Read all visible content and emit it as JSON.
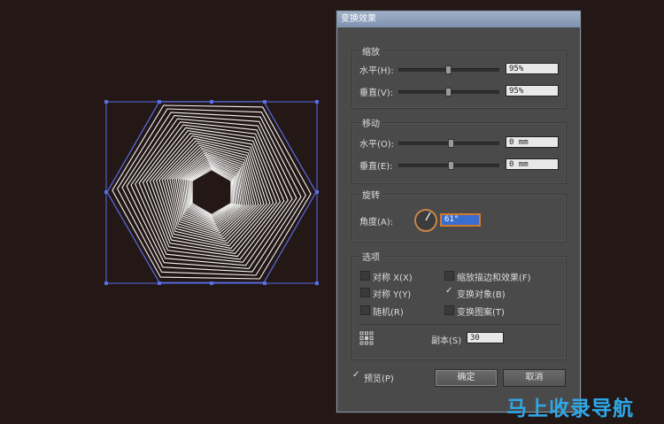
{
  "dialog": {
    "title": "变换效果",
    "scale": {
      "label": "缩放",
      "horizontal": {
        "label": "水平(H):",
        "value": "95%"
      },
      "vertical": {
        "label": "垂直(V):",
        "value": "95%"
      }
    },
    "move": {
      "label": "移动",
      "horizontal": {
        "label": "水平(O):",
        "value": "0 mm"
      },
      "vertical": {
        "label": "垂直(E):",
        "value": "0 mm"
      }
    },
    "rotate": {
      "label": "旋转",
      "angle": {
        "label": "角度(A):",
        "value": "61°"
      }
    },
    "options": {
      "label": "选项",
      "reflect_x": {
        "label": "对称 X(X)",
        "checked": false
      },
      "reflect_y": {
        "label": "对称 Y(Y)",
        "checked": false
      },
      "random": {
        "label": "随机(R)",
        "checked": false
      },
      "scale_strokes": {
        "label": "缩放描边和效果(F)",
        "checked": false
      },
      "transform_objects": {
        "label": "变换对象(B)",
        "checked": true
      },
      "transform_patterns": {
        "label": "变换图案(T)",
        "checked": false
      },
      "copies": {
        "label": "副本(S)",
        "value": "30"
      }
    },
    "preview": {
      "label": "预览(P)",
      "checked": true
    },
    "ok_label": "确定",
    "cancel_label": "取消"
  },
  "watermark": "马上收录导航",
  "colors": {
    "background": "#231816",
    "dialog": "#4a4a4a",
    "selection": "#5a6ee8",
    "accent_field": "#3a6dd0",
    "watermark": "#2ea8e8"
  }
}
